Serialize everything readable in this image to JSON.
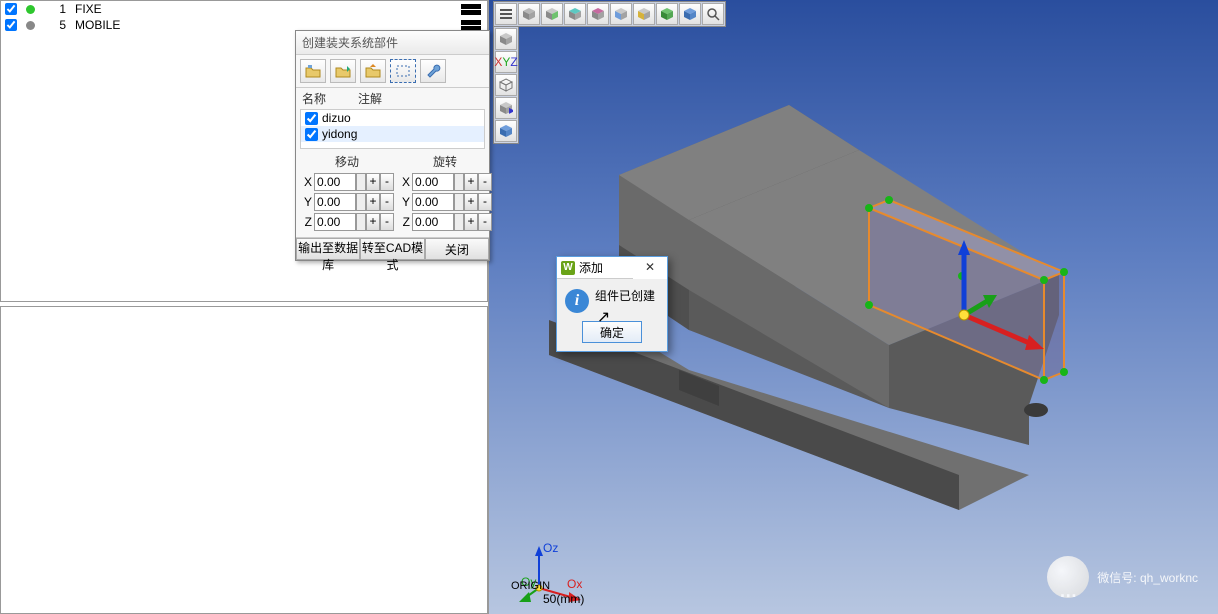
{
  "tree": {
    "rows": [
      {
        "num": "1",
        "label": "FIXE",
        "dot": "#2ec72e"
      },
      {
        "num": "5",
        "label": "MOBILE",
        "dot": "#888888"
      }
    ]
  },
  "create_dialog": {
    "title": "创建装夹系统部件",
    "col_name": "名称",
    "col_note": "注解",
    "items": [
      {
        "label": "dizuo",
        "selected": false
      },
      {
        "label": "yidong",
        "selected": true
      }
    ],
    "move": {
      "header": "移动",
      "x": "0.00",
      "y": "0.00",
      "z": "0.00"
    },
    "rotate": {
      "header": "旋转",
      "x": "0.00",
      "y": "0.00",
      "z": "0.00"
    },
    "axis": {
      "x": "X",
      "y": "Y",
      "z": "Z"
    },
    "btn_export": "输出至数据库",
    "btn_cad": "转至CAD模式",
    "btn_close": "关闭"
  },
  "msgbox": {
    "title": "添加",
    "text": "组件已创建",
    "ok": "确定"
  },
  "origin": {
    "label": "ORIGIN",
    "ox": "Ox",
    "oy": "Oy",
    "oz": "Oz"
  },
  "scale": "50(mm)",
  "watermark": "微信号: qh_worknc",
  "cubes": {
    "iso": {
      "top": "#b8b8b8",
      "left": "#8a8a8a",
      "right": "#a3a3a3"
    },
    "green": {
      "top": "#6fc26f",
      "left": "#388a38",
      "right": "#54a754"
    },
    "blue": {
      "top": "#6f9ddb",
      "left": "#3a6db0",
      "right": "#5486c7"
    },
    "teal": {
      "top": "#5cc9c2",
      "left": "#2e8f89",
      "right": "#45ada6"
    }
  }
}
